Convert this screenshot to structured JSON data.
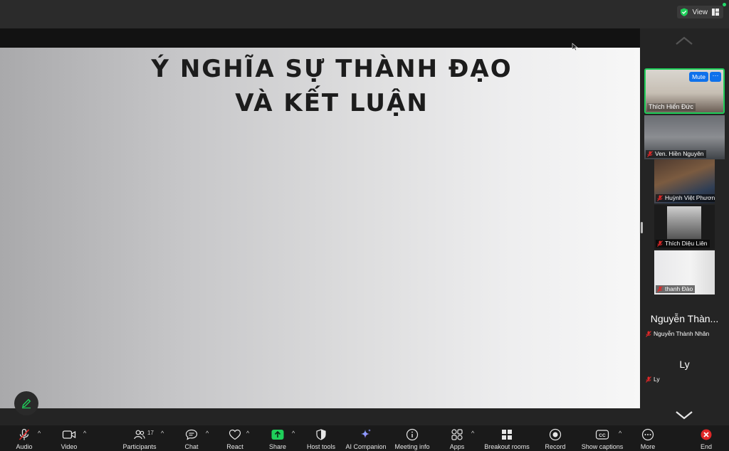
{
  "window": {
    "view_label": "View"
  },
  "slide": {
    "title_line1": "Ý NGHĨA SỰ THÀNH ĐẠO",
    "title_line2": "VÀ KẾT LUẬN"
  },
  "participants_panel": {
    "mute_label": "Mute",
    "more_label": "···",
    "tiles": [
      {
        "name": "Thích Hiển Đức",
        "muted": false,
        "active_speaker": true
      },
      {
        "name": "Ven. Hiền Nguyên",
        "muted": true
      },
      {
        "name": "Huỳnh Việt Phương",
        "muted": true
      },
      {
        "name": "Thích Diệu Liên",
        "muted": true
      },
      {
        "name": "thanh Đào",
        "muted": true
      },
      {
        "name": "Nguyễn Thành Nhân",
        "display_name": "Nguyễn Thàn...",
        "muted": true
      },
      {
        "name": "Ly",
        "display_name": "Ly",
        "muted": true
      }
    ]
  },
  "toolbar": {
    "audio": "Audio",
    "video": "Video",
    "participants": "Participants",
    "participants_count": "17",
    "chat": "Chat",
    "react": "React",
    "share": "Share",
    "host_tools": "Host tools",
    "ai_companion": "AI Companion",
    "meeting_info": "Meeting info",
    "apps": "Apps",
    "breakout_rooms": "Breakout rooms",
    "record": "Record",
    "show_captions": "Show captions",
    "more": "More",
    "end": "End",
    "caret": "^"
  },
  "colors": {
    "active_speaker_border": "#1fcf5a",
    "mute_button": "#0e71eb",
    "share_green": "#1fcf5a",
    "end_red": "#e02828",
    "muted_red": "#e02828"
  }
}
